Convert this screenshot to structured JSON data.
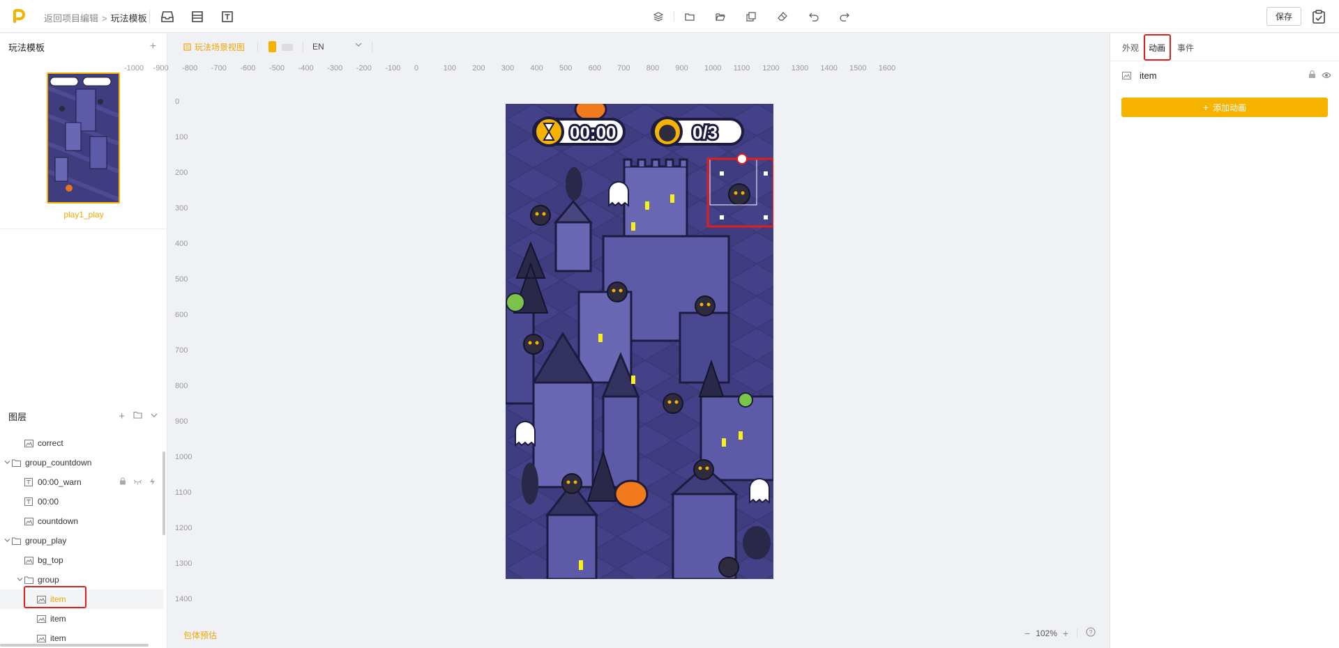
{
  "header": {
    "back_label": "返回项目编辑",
    "separator": ">",
    "current_label": "玩法模板",
    "save_label": "保存"
  },
  "template_panel": {
    "title": "玩法模板",
    "thumb_label": "play1_play"
  },
  "layers": {
    "title": "图层",
    "rows": [
      {
        "label": "correct",
        "icon": "image-icon",
        "indent": 2
      },
      {
        "label": "group_countdown",
        "icon": "folder-icon",
        "indent": 1,
        "expanded": true
      },
      {
        "label": "00:00_warn",
        "icon": "text-icon",
        "indent": 2
      },
      {
        "label": "00:00",
        "icon": "text-icon",
        "indent": 2
      },
      {
        "label": "countdown",
        "icon": "image-icon",
        "indent": 2
      },
      {
        "label": "group_play",
        "icon": "folder-icon",
        "indent": 1,
        "expanded": true
      },
      {
        "label": "bg_top",
        "icon": "image-icon",
        "indent": 2
      },
      {
        "label": "group",
        "icon": "folder-icon",
        "indent": 2,
        "expanded": true
      },
      {
        "label": "item",
        "icon": "image-icon",
        "indent": 3,
        "active": true
      },
      {
        "label": "item",
        "icon": "image-icon",
        "indent": 3
      },
      {
        "label": "item",
        "icon": "image-icon",
        "indent": 3
      }
    ]
  },
  "canvas": {
    "scene_tab": "玩法场景视图",
    "language": "EN",
    "ruler_x": [
      "-1000",
      "-900",
      "-800",
      "-700",
      "-600",
      "-500",
      "-400",
      "-300",
      "-200",
      "-100",
      "0",
      "100",
      "200",
      "300",
      "400",
      "500",
      "600",
      "700",
      "800",
      "900",
      "1000",
      "1100",
      "1200",
      "1300",
      "1400",
      "1500",
      "1600"
    ],
    "ruler_y": [
      "0",
      "100",
      "200",
      "300",
      "400",
      "500",
      "600",
      "700",
      "800",
      "900",
      "1000",
      "1100",
      "1200",
      "1300",
      "1400"
    ],
    "bottom_label": "包体预估",
    "zoom": "102%",
    "timer_text": "00:00",
    "counter_text": "0/3"
  },
  "right_panel": {
    "tabs": [
      "外观",
      "动画",
      "事件"
    ],
    "active_tab": "动画",
    "item_label": "item",
    "add_button": "添加动画"
  },
  "colors": {
    "accent": "#f5b300",
    "highlight": "#e21d1d",
    "scene_bg": "#3f3c80"
  }
}
